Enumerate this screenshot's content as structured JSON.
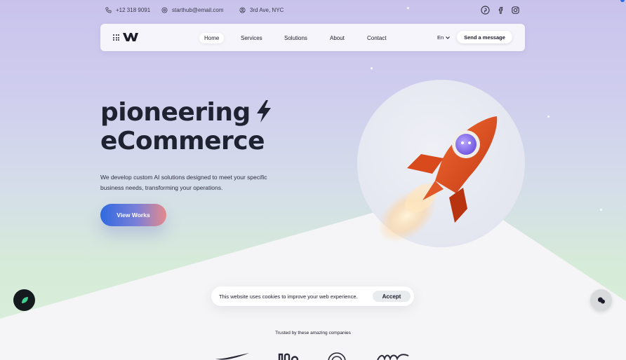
{
  "topbar": {
    "phone": "+12 318 9091",
    "email": "starthub@email.com",
    "address": "3rd Ave, NYC",
    "socials": [
      "pinterest-icon",
      "facebook-icon",
      "instagram-icon"
    ]
  },
  "nav": {
    "items": [
      {
        "label": "Home",
        "active": true
      },
      {
        "label": "Services",
        "active": false
      },
      {
        "label": "Solutions",
        "active": false
      },
      {
        "label": "About",
        "active": false
      },
      {
        "label": "Contact",
        "active": false
      }
    ],
    "lang": "En",
    "cta": "Send a message"
  },
  "hero": {
    "title_line1": "pioneering",
    "title_line2": "eCommerce",
    "description": "We develop custom AI solutions designed to meet your specific business needs, transforming your operations.",
    "button": "View Works"
  },
  "cookie": {
    "text": "This website uses cookies to improve your web experience.",
    "accept": "Accept"
  },
  "trusted": {
    "label": "Trusted by these amazing companies"
  },
  "colors": {
    "accent_blue": "#2f6ae0",
    "rocket_orange": "#e1501f",
    "dark": "#1f2230"
  }
}
